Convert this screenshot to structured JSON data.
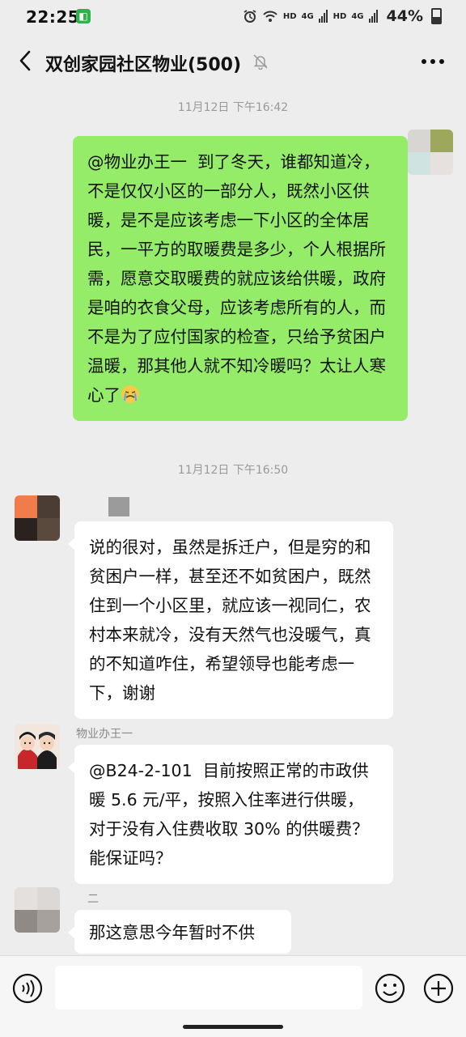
{
  "status_bar": {
    "time": "22:25",
    "hd1": "HD",
    "sig1": "4G",
    "hd2": "HD",
    "sig2": "4G",
    "battery": "44%"
  },
  "header": {
    "title": "双创家园社区物业(500)"
  },
  "messages": {
    "ts1": "11月12日 下午16:42",
    "msg1": "@物业办王一  到了冬天，谁都知道冷，不是仅仅小区的一部分人，既然小区供暖，是不是应该考虑一下小区的全体居民，一平方的取暖费是多少，个人根据所需，愿意交取暖费的就应该给供暖，政府是咱的衣食父母，应该考虑所有的人，而不是为了应付国家的检查，只给予贫困户温暖，那其他人就不知冷暖吗？太让人寒心了",
    "ts2": "11月12日 下午16:50",
    "msg2": "说的很对，虽然是拆迁户，但是穷的和贫困户一样，甚至还不如贫困户，既然住到一个小区里，就应该一视同仁，农村本来就冷，没有天然气也没暖气，真的不知道咋住，希望领导也能考虑一下，谢谢",
    "sender3": "物业办王一",
    "msg3": "@B24-2-101  目前按照正常的市政供暖 5.6 元/平，按照入住率进行供暖，对于没有入住费收取 30% 的供暖费？能保证吗？",
    "sender4": "二",
    "msg4": "那这意思今年暂时不供"
  },
  "icons": {
    "back": "chevron-left-icon",
    "mute": "bell-off-icon",
    "more": "more-dots-icon",
    "voice": "voice-icon",
    "emoji": "emoji-icon",
    "plus": "plus-icon"
  },
  "colors": {
    "background": "#ededed",
    "self_bubble": "#95ec69",
    "other_bubble": "#ffffff"
  }
}
